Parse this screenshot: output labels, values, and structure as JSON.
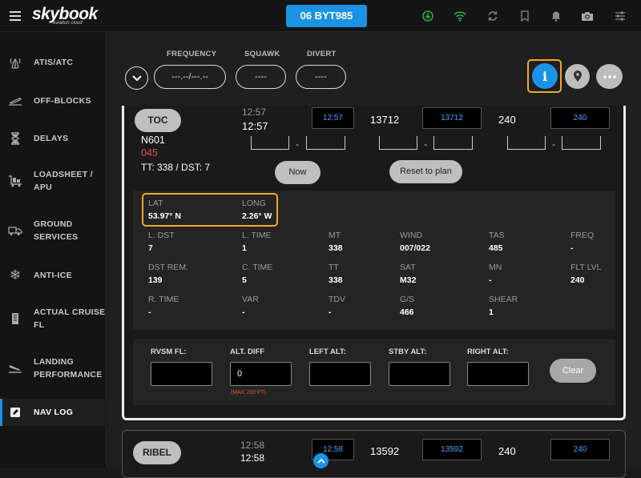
{
  "app": {
    "logo": "skybook",
    "logo_sub": "aviation cloud",
    "flight": "06 BYT985"
  },
  "colors": {
    "accent": "#1a93e6",
    "highlight": "#f5a623",
    "alert": "#e05050",
    "link_blue": "#4aa3ff"
  },
  "top_icons": [
    "download-icon",
    "wifi-icon",
    "sync-icon",
    "bookmark-icon",
    "bell-icon",
    "camera-icon",
    "sliders-icon"
  ],
  "sidebar": {
    "items": [
      {
        "label_1": "ATIS/ATC",
        "label_2": "",
        "icon": "radio-tower-icon"
      },
      {
        "label_1": "OFF-BLOCKS",
        "label_2": "",
        "icon": "plane-takeoff-icon"
      },
      {
        "label_1": "DELAYS",
        "label_2": "",
        "icon": "hourglass-icon"
      },
      {
        "label_1": "LOADSHEET /",
        "label_2": "APU",
        "icon": "luggage-cart-icon"
      },
      {
        "label_1": "GROUND",
        "label_2": "SERVICES",
        "icon": "fuel-truck-icon"
      },
      {
        "label_1": "ANTI-ICE",
        "label_2": "",
        "icon": "snowflake-icon"
      },
      {
        "label_1": "ACTUAL CRUISE",
        "label_2": "FL",
        "icon": "document-icon"
      },
      {
        "label_1": "LANDING",
        "label_2": "PERFORMANCE",
        "icon": "plane-landing-icon"
      },
      {
        "label_1": "NAV LOG",
        "label_2": "",
        "icon": "edit-icon"
      }
    ]
  },
  "header": {
    "frequency_label": "FREQUENCY",
    "frequency_value": "---.--/---.--",
    "squawk_label": "SQUAWK",
    "squawk_value": "----",
    "divert_label": "DIVERT",
    "divert_value": "----"
  },
  "waypoint": {
    "name": "TOC",
    "time_planned": "12:57",
    "time_actual": "12:57",
    "time_box": "12:57",
    "alt_value": "13712",
    "alt_box": "13712",
    "fuel_value": "240",
    "fuel_box": "240",
    "tail": "N601",
    "code": "045",
    "tt_dst": "TT: 338 / DST: 7",
    "dash": "-",
    "now_button": "Now",
    "reset_button": "Reset to plan"
  },
  "info": {
    "lat_label": "LAT",
    "lat_value": "53.97° N",
    "long_label": "LONG",
    "long_value": "2.26° W",
    "rows": [
      [
        {
          "l": "L. DST",
          "v": "7"
        },
        {
          "l": "L. TIME",
          "v": "1"
        },
        {
          "l": "MT",
          "v": "338"
        },
        {
          "l": "WIND",
          "v": "007/022"
        },
        {
          "l": "TAS",
          "v": "485"
        },
        {
          "l": "FREQ",
          "v": "-"
        }
      ],
      [
        {
          "l": "DST REM.",
          "v": "139"
        },
        {
          "l": "C. TIME",
          "v": "5"
        },
        {
          "l": "TT",
          "v": "338"
        },
        {
          "l": "SAT",
          "v": "M32"
        },
        {
          "l": "MN",
          "v": "-"
        },
        {
          "l": "FLT LVL",
          "v": "240"
        }
      ],
      [
        {
          "l": "R. TIME",
          "v": "-"
        },
        {
          "l": "VAR",
          "v": "-"
        },
        {
          "l": "TDV",
          "v": "-"
        },
        {
          "l": "G/S",
          "v": "466"
        },
        {
          "l": "SHEAR",
          "v": "1"
        }
      ]
    ]
  },
  "altitudes": {
    "rvsm_label": "RVSM FL:",
    "rvsm_value": "",
    "diff_label": "ALT. DIFF",
    "diff_value": "0",
    "diff_hint": "(MAX 200 FT)",
    "left_label": "LEFT ALT:",
    "left_value": "",
    "stby_label": "STBY ALT:",
    "stby_value": "",
    "right_label": "RIGHT ALT:",
    "right_value": "",
    "clear_button": "Clear"
  },
  "next_waypoint": {
    "name": "RIBEL",
    "time_planned": "12:58",
    "time_actual": "12:58",
    "time_box": "12:58",
    "alt_value": "13592",
    "alt_box": "13592",
    "fuel_value": "240",
    "fuel_box": "240"
  }
}
